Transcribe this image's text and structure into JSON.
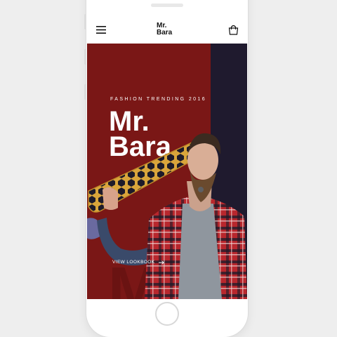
{
  "app": {
    "logo_line1": "Mr.",
    "logo_line2": "Bara"
  },
  "hero": {
    "tagline": "FASHION TRENDING 2016",
    "title_line1": "Mr.",
    "title_line2": "Bara",
    "cta_label": "VIEW LOOKBOOK",
    "background_letters": "MR"
  },
  "icons": {
    "menu": "hamburger-menu-icon",
    "cart": "shopping-bag-icon",
    "cta": "arrow-right-icon"
  },
  "colors": {
    "hero_red": "#7a1716",
    "band_navy": "#1f1a2e",
    "shirt_red": "#b8272d",
    "board_gold": "#d9a53b"
  }
}
